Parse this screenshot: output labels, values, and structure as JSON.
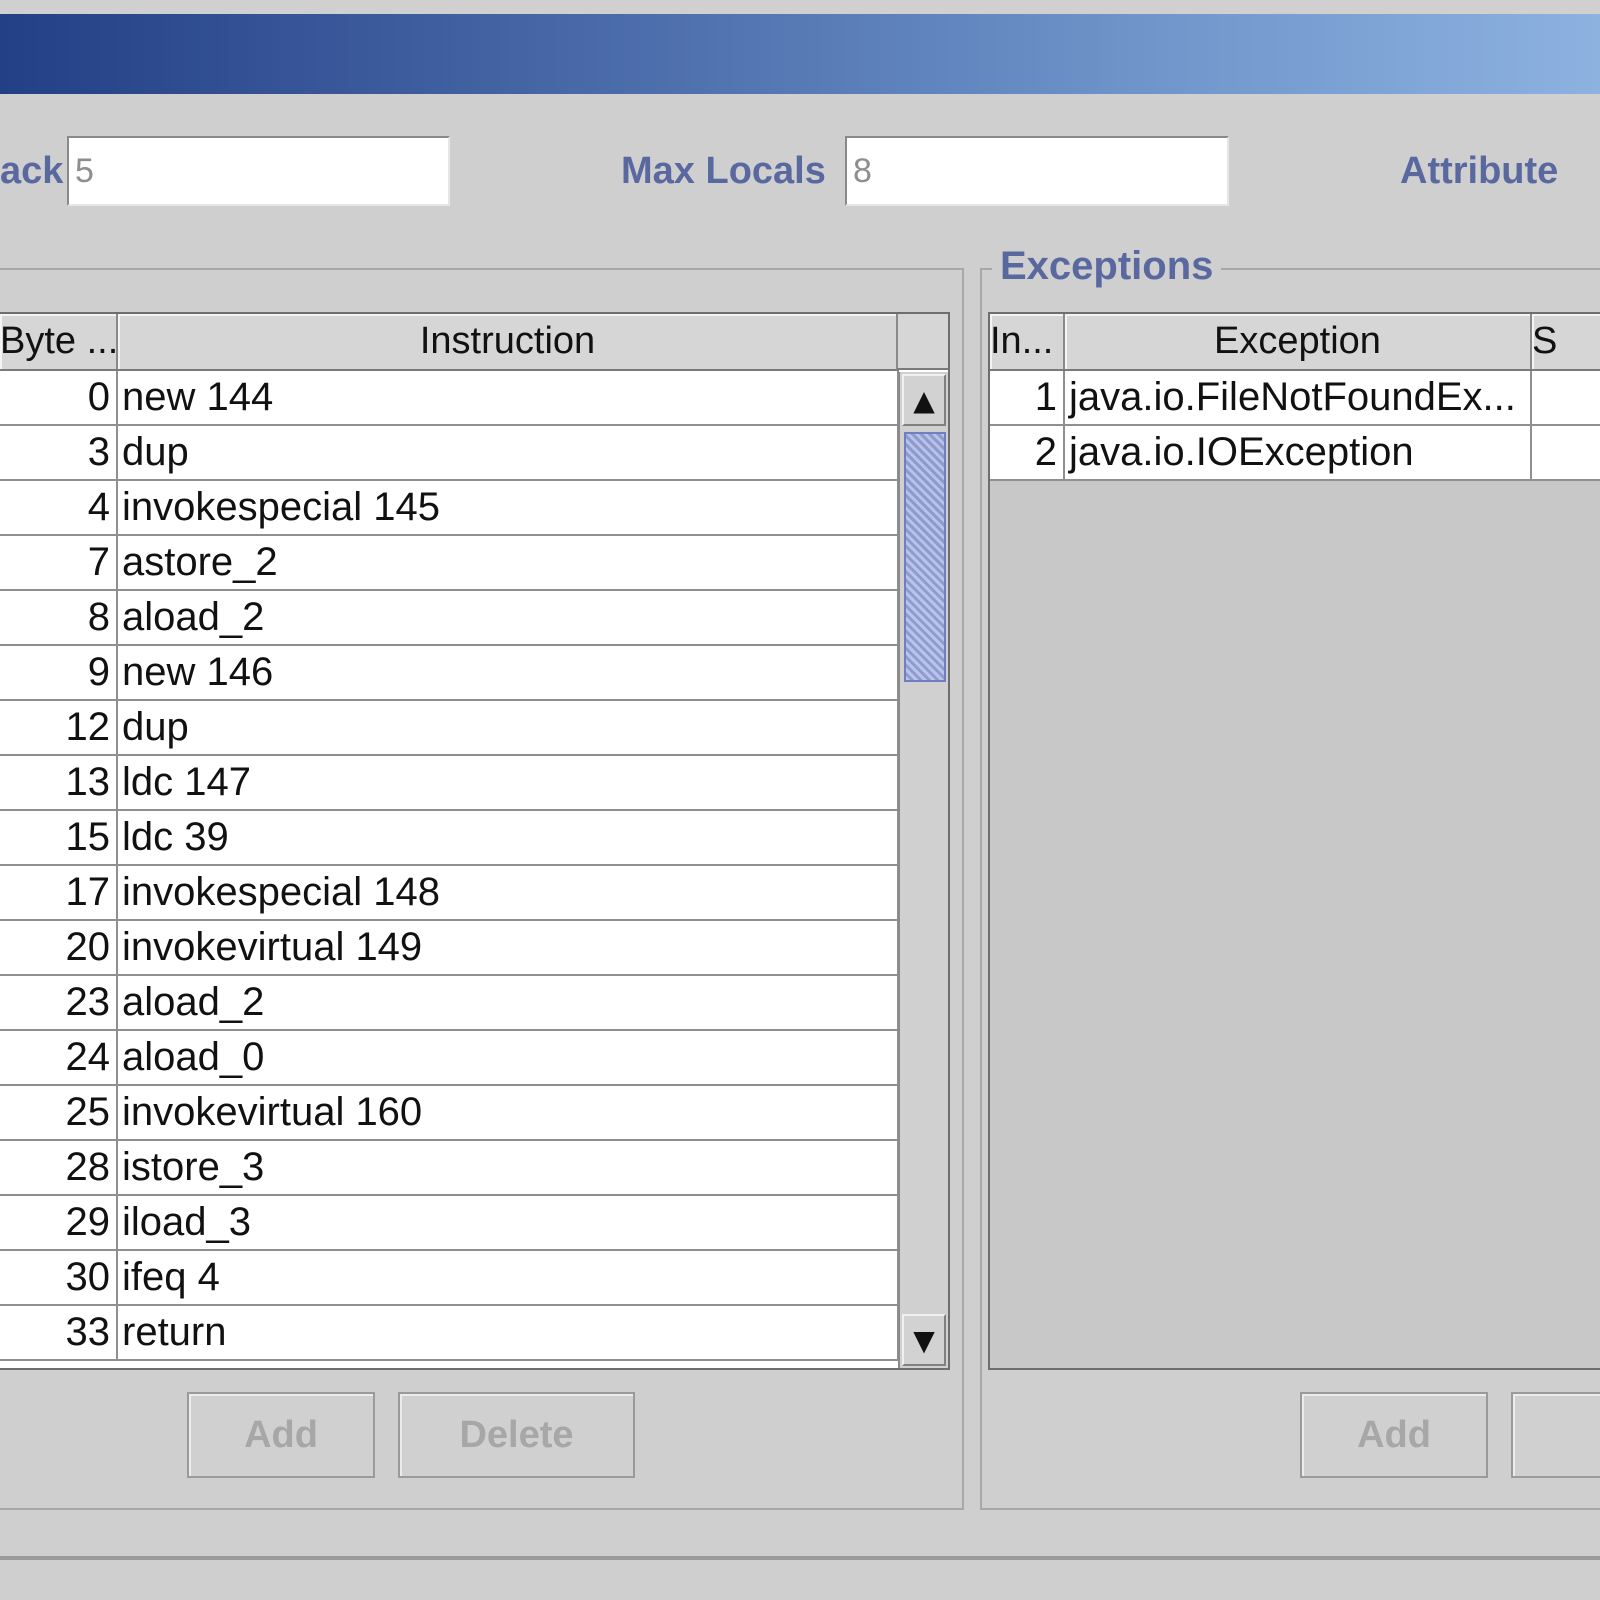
{
  "fields": {
    "max_stack_label": "ack",
    "max_stack_value": "5",
    "max_locals_label": "Max Locals",
    "max_locals_value": "8",
    "attributes_label": "Attribute"
  },
  "code_table": {
    "columns": [
      "Byte ...",
      "Instruction"
    ],
    "rows": [
      {
        "offset": "0",
        "instr": "new 144"
      },
      {
        "offset": "3",
        "instr": "dup"
      },
      {
        "offset": "4",
        "instr": "invokespecial 145"
      },
      {
        "offset": "7",
        "instr": "astore_2"
      },
      {
        "offset": "8",
        "instr": "aload_2"
      },
      {
        "offset": "9",
        "instr": "new 146"
      },
      {
        "offset": "12",
        "instr": "dup"
      },
      {
        "offset": "13",
        "instr": "ldc 147"
      },
      {
        "offset": "15",
        "instr": "ldc 39"
      },
      {
        "offset": "17",
        "instr": "invokespecial 148"
      },
      {
        "offset": "20",
        "instr": "invokevirtual 149"
      },
      {
        "offset": "23",
        "instr": "aload_2"
      },
      {
        "offset": "24",
        "instr": "aload_0"
      },
      {
        "offset": "25",
        "instr": "invokevirtual 160"
      },
      {
        "offset": "28",
        "instr": "istore_3"
      },
      {
        "offset": "29",
        "instr": "iload_3"
      },
      {
        "offset": "30",
        "instr": "ifeq 4"
      },
      {
        "offset": "33",
        "instr": "return"
      }
    ],
    "add_label": "Add",
    "delete_label": "Delete"
  },
  "exceptions": {
    "title": "Exceptions",
    "columns": [
      "In...",
      "Exception",
      "S"
    ],
    "rows": [
      {
        "index": "1",
        "name": "java.io.FileNotFoundEx..."
      },
      {
        "index": "2",
        "name": "java.io.IOException"
      }
    ],
    "add_label": "Add"
  }
}
